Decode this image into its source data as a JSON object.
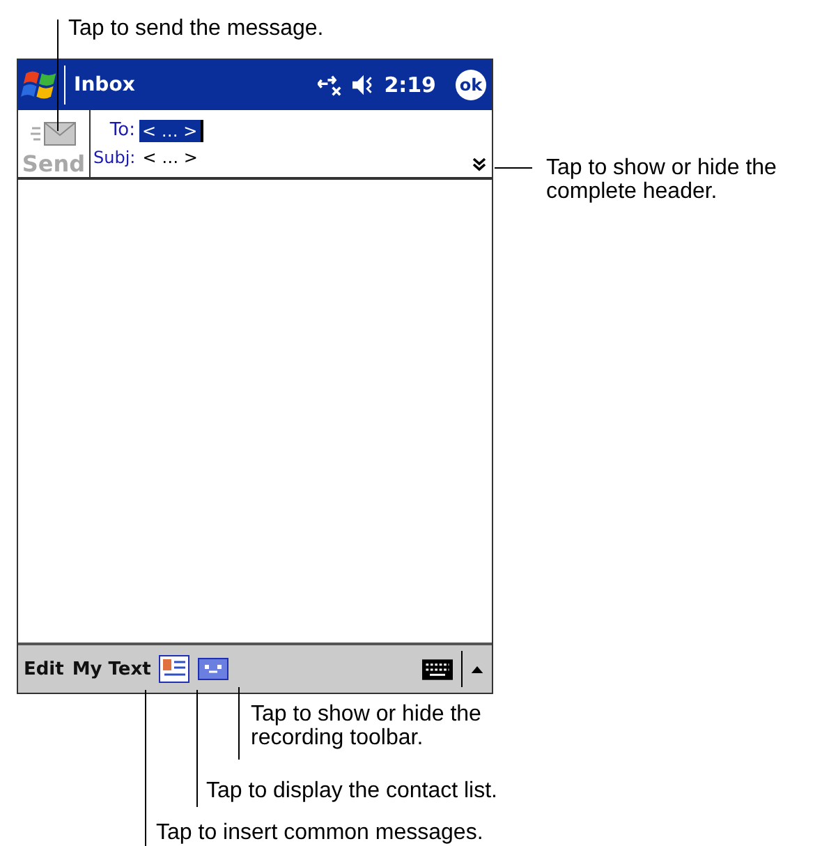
{
  "title_bar": {
    "title": "Inbox",
    "time": "2:19",
    "ok_label": "ok"
  },
  "header": {
    "send_label": "Send",
    "send_disabled": true,
    "fields": [
      {
        "label": "To:",
        "value": "< … >",
        "selected": true
      },
      {
        "label": "Subj:",
        "value": "< … >",
        "selected": false
      }
    ]
  },
  "menu_bar": {
    "items": [
      "Edit",
      "My Text"
    ]
  },
  "callouts": [
    "Tap to send the message.",
    "Tap to show or hide the complete header.",
    "Tap to show or hide the recording toolbar.",
    "Tap to display the contact list.",
    "Tap to insert common messages."
  ]
}
